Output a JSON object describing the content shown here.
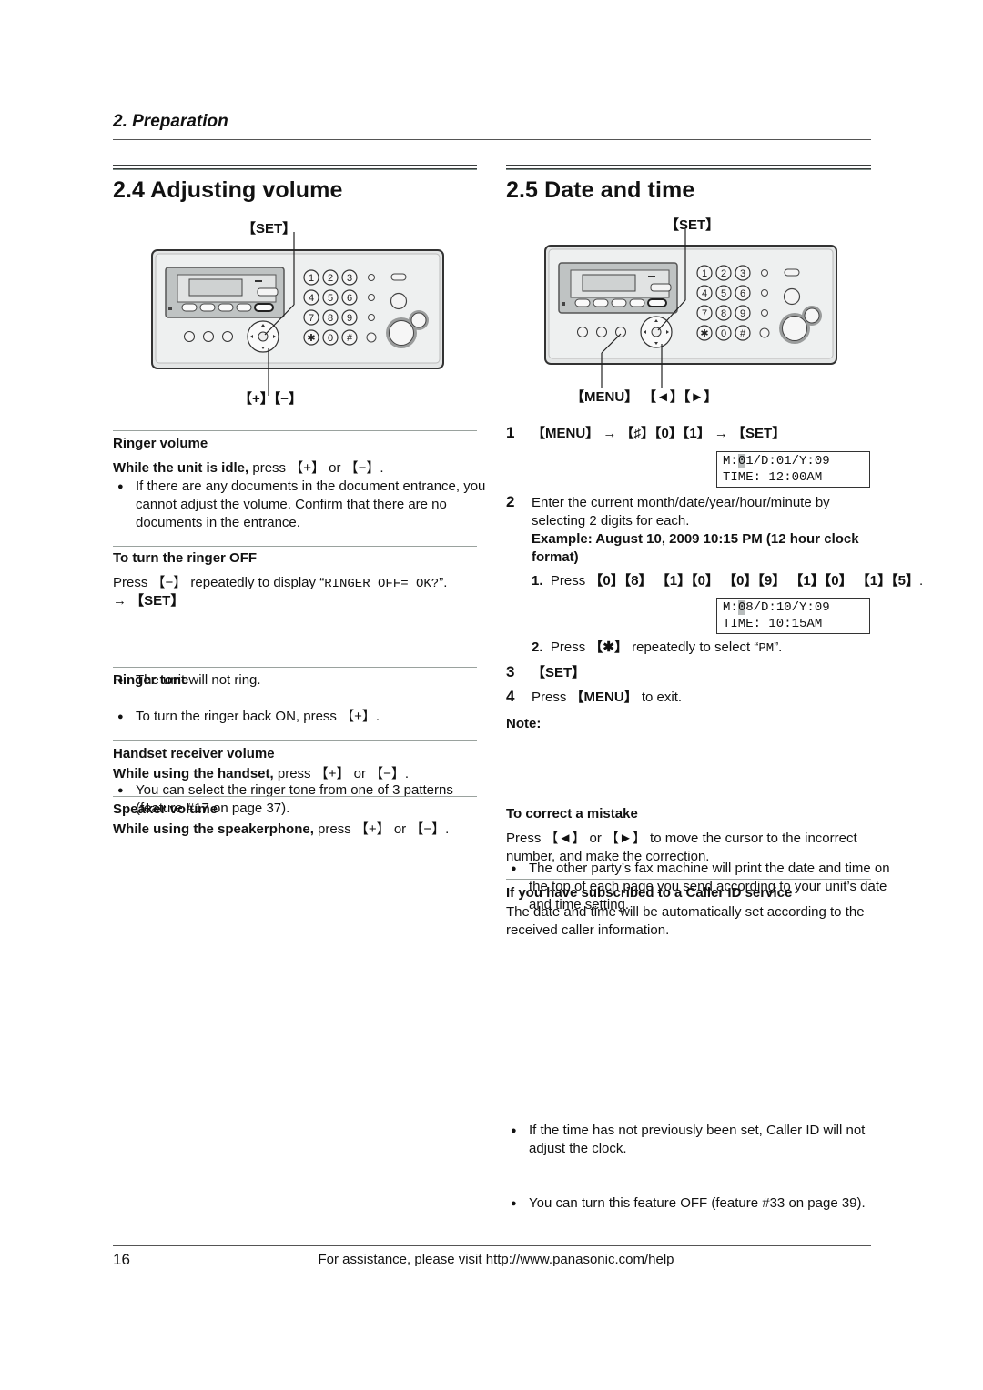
{
  "header": {
    "section": "2. Preparation"
  },
  "left": {
    "title": "2.4 Adjusting volume",
    "diagram": {
      "set_label": "【SET】",
      "plus_minus_label": "【+】【−】"
    },
    "ringer_volume": {
      "heading": "Ringer volume",
      "instr_bold": "While the unit is idle,",
      "instr_rest": " press 【+】 or 【−】.",
      "bullet": "If there are any documents in the document entrance, you cannot adjust the volume. Confirm that there are no documents in the entrance."
    },
    "ringer_off": {
      "heading": "To turn the ringer OFF",
      "line1_a": "Press 【−】 repeatedly to display “",
      "line1_display": "RINGER OFF= OK?",
      "line1_b": "”.",
      "line2": "→ 【SET】",
      "bullets": [
        "The unit will not ring.",
        "To turn the ringer back ON, press 【+】."
      ]
    },
    "ringer_tone": {
      "heading": "Ringer tone",
      "bullet": "You can select the ringer tone from one of 3 patterns (feature #17 on page 37)."
    },
    "handset_volume": {
      "heading": "Handset receiver volume",
      "instr_bold": "While using the handset,",
      "instr_rest": " press 【+】 or 【−】."
    },
    "speaker_volume": {
      "heading": "Speaker volume",
      "instr_bold": "While using the speakerphone,",
      "instr_rest": " press 【+】 or 【−】."
    }
  },
  "right": {
    "title": "2.5 Date and time",
    "diagram": {
      "set_label": "【SET】",
      "menu_label": "【MENU】",
      "arrows_label": "【◄】【►】"
    },
    "steps": [
      {
        "num": "1",
        "text": "【MENU】 → 【♯】【0】【1】 → 【SET】",
        "display": {
          "line1_pre": "M:",
          "line1_hl": "0",
          "line1_post": "1/D:01/Y:09",
          "line2": "TIME: 12:00AM"
        }
      },
      {
        "num": "2",
        "text": "Enter the current month/date/year/hour/minute by selecting 2 digits for each.",
        "example": "Example: August 10, 2009 10:15 PM (12 hour clock format)",
        "sub1_num": "1.",
        "sub1_a": "Press ",
        "sub1_keys": "【0】【8】 【1】【0】 【0】【9】 【1】【0】 【1】【5】",
        "sub1_b": ".",
        "display": {
          "line1_pre": "M:",
          "line1_hl": "0",
          "line1_post": "8/D:10/Y:09",
          "line2": "TIME: 10:15AM"
        },
        "sub2_num": "2.",
        "sub2_a": "Press ",
        "sub2_key": "【✱】",
        "sub2_b": " repeatedly to select “",
        "sub2_display": "PM",
        "sub2_c": "”."
      },
      {
        "num": "3",
        "text": "【SET】"
      },
      {
        "num": "4",
        "text_a": "Press ",
        "text_key": "【MENU】",
        "text_b": " to exit."
      }
    ],
    "note": {
      "heading": "Note:",
      "bullet": "The other party’s fax machine will print the date and time on the top of each page you send according to your unit’s date and time setting."
    },
    "correct": {
      "heading": "To correct a mistake",
      "text": "Press 【◄】 or 【►】 to move the cursor to the incorrect number, and make the correction."
    },
    "caller_id": {
      "heading": "If you have subscribed to a Caller ID service",
      "text": "The date and time will be automatically set according to the received caller information.",
      "bullets": [
        "If the time has not previously been set, Caller ID will not adjust the clock.",
        "You can turn this feature OFF (feature #33 on page 39)."
      ]
    }
  },
  "footer": {
    "page_number": "16",
    "assistance": "For assistance, please visit http://www.panasonic.com/help"
  },
  "device": {
    "keypad": [
      "1",
      "2",
      "3",
      "4",
      "5",
      "6",
      "7",
      "8",
      "9",
      "✱",
      "0",
      "#"
    ]
  }
}
